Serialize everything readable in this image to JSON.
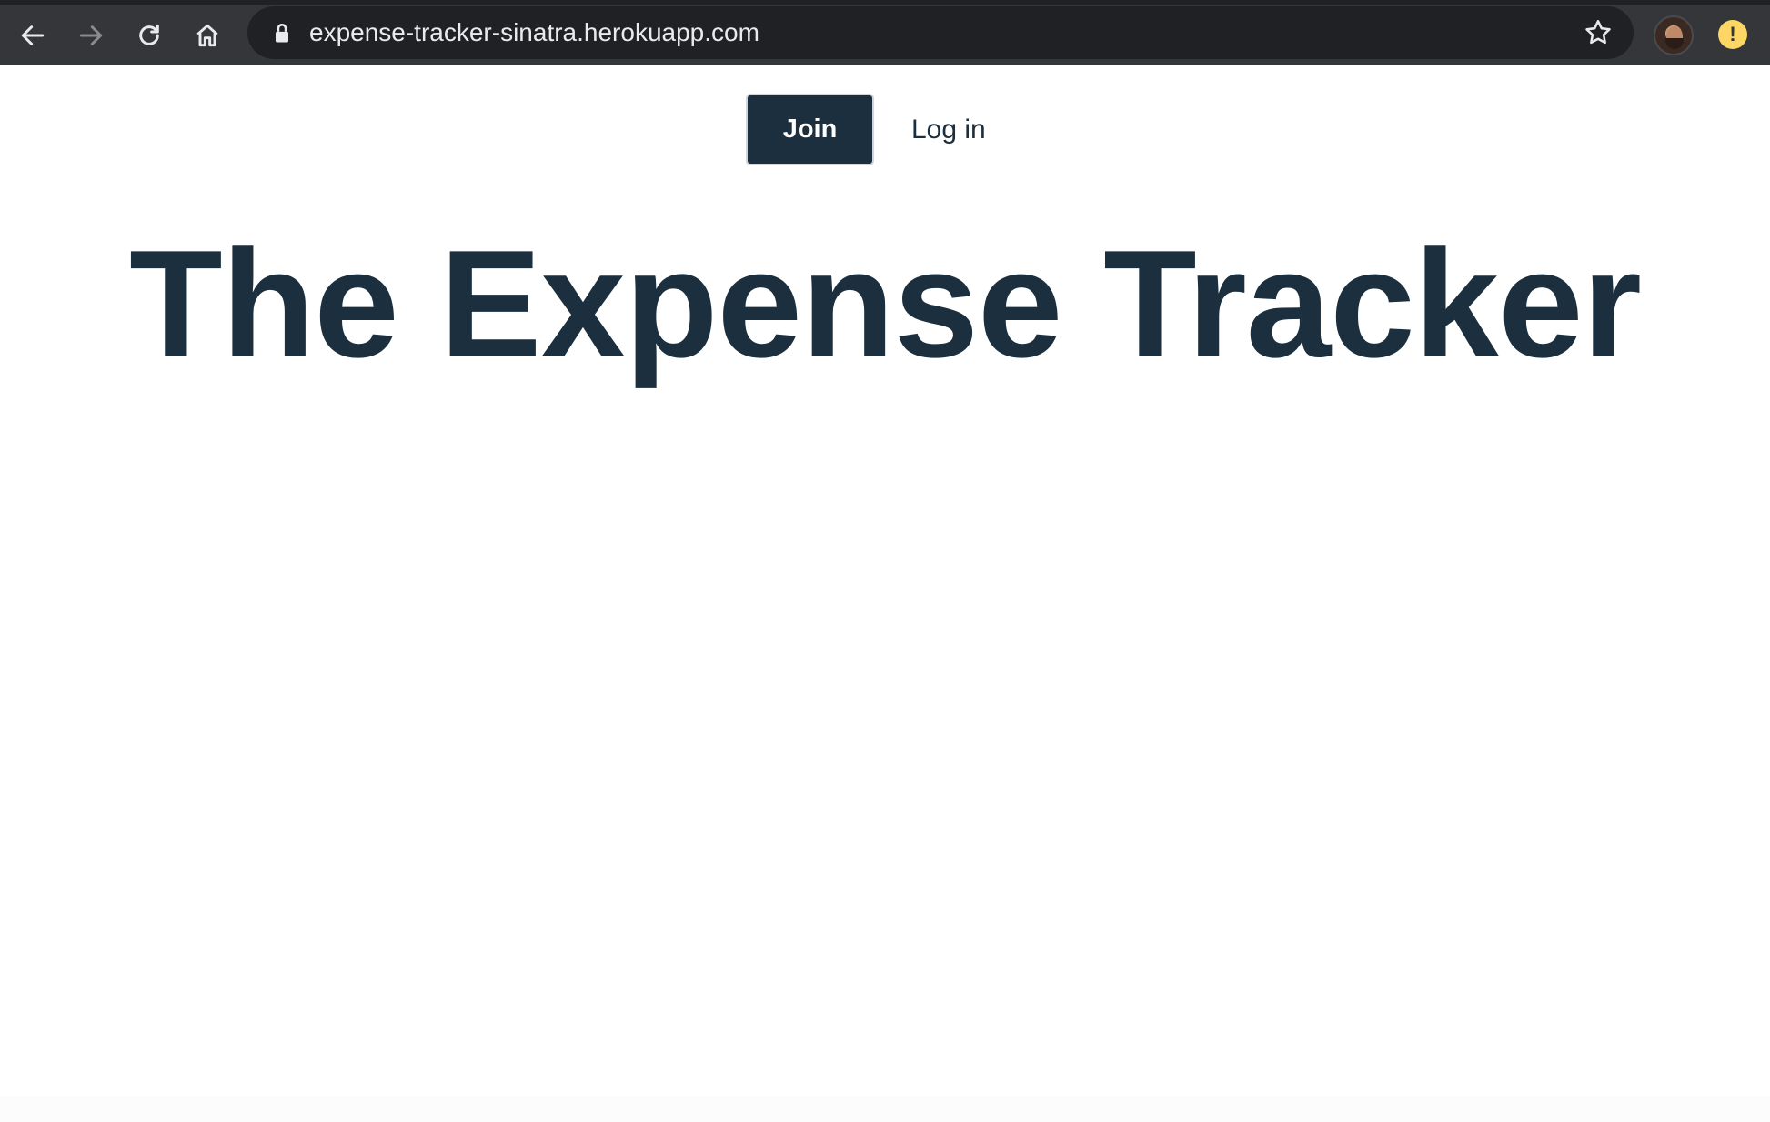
{
  "browser": {
    "url": "expense-tracker-sinatra.herokuapp.com",
    "icons": {
      "back": "arrow-left-icon",
      "forward": "arrow-right-icon",
      "reload": "reload-icon",
      "home": "home-icon",
      "lock": "lock-icon",
      "bookmark": "star-icon",
      "profile": "avatar",
      "alert": "alert-icon"
    },
    "alert_glyph": "!"
  },
  "nav": {
    "join_label": "Join",
    "login_label": "Log in"
  },
  "hero": {
    "title": "The Expense Tracker"
  },
  "colors": {
    "primary": "#1c2f3e",
    "toolbar": "#35363a",
    "omnibox": "#202124",
    "alert": "#fdd663"
  }
}
